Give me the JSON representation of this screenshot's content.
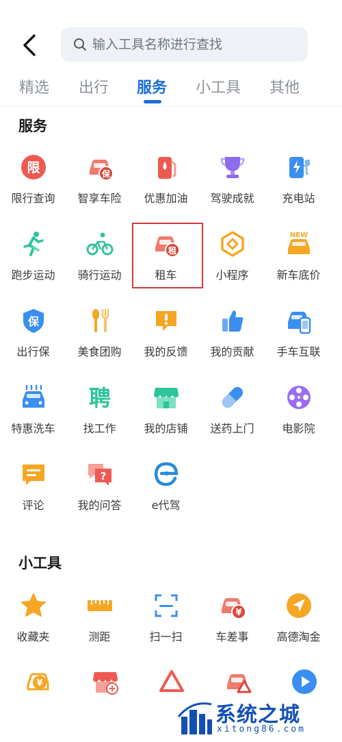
{
  "search": {
    "placeholder": "输入工具名称进行查找"
  },
  "tabs": [
    {
      "label": "精选"
    },
    {
      "label": "出行"
    },
    {
      "label": "服务"
    },
    {
      "label": "小工具"
    },
    {
      "label": "其他"
    }
  ],
  "active_tab": "服务",
  "sections": {
    "service": {
      "title": "服务",
      "items": [
        {
          "label": "限行查询",
          "icon": "restriction-icon"
        },
        {
          "label": "智享车险",
          "icon": "car-insurance-icon"
        },
        {
          "label": "优惠加油",
          "icon": "fuel-icon"
        },
        {
          "label": "驾驶成就",
          "icon": "trophy-icon"
        },
        {
          "label": "充电站",
          "icon": "charging-icon"
        },
        {
          "label": "跑步运动",
          "icon": "running-icon"
        },
        {
          "label": "骑行运动",
          "icon": "cycling-icon"
        },
        {
          "label": "租车",
          "icon": "car-rental-icon",
          "highlighted": true
        },
        {
          "label": "小程序",
          "icon": "mini-program-icon"
        },
        {
          "label": "新车底价",
          "icon": "new-car-icon"
        },
        {
          "label": "出行保",
          "icon": "shield-icon"
        },
        {
          "label": "美食团购",
          "icon": "food-icon"
        },
        {
          "label": "我的反馈",
          "icon": "feedback-icon"
        },
        {
          "label": "我的贡献",
          "icon": "thumbs-up-icon"
        },
        {
          "label": "手车互联",
          "icon": "phone-car-icon"
        },
        {
          "label": "特惠洗车",
          "icon": "car-wash-icon"
        },
        {
          "label": "找工作",
          "icon": "job-icon"
        },
        {
          "label": "我的店铺",
          "icon": "shop-icon"
        },
        {
          "label": "送药上门",
          "icon": "pill-icon"
        },
        {
          "label": "电影院",
          "icon": "film-reel-icon"
        },
        {
          "label": "评论",
          "icon": "comment-icon"
        },
        {
          "label": "我的问答",
          "icon": "qa-icon"
        },
        {
          "label": "e代驾",
          "icon": "e-driver-icon"
        }
      ]
    },
    "tools": {
      "title": "小工具",
      "items": [
        {
          "label": "收藏夹",
          "icon": "star-icon"
        },
        {
          "label": "测距",
          "icon": "ruler-icon"
        },
        {
          "label": "扫一扫",
          "icon": "scan-icon"
        },
        {
          "label": "车差事",
          "icon": "car-expense-icon"
        },
        {
          "label": "高德淘金",
          "icon": "gold-rush-icon"
        }
      ]
    }
  },
  "badges": {
    "new": "NEW",
    "rent": "租",
    "insurance": "保",
    "service": "保",
    "yuan": "¥",
    "e": "e",
    "job": "聘",
    "question": "?"
  },
  "watermark": {
    "title": "系统之城",
    "url": "xitong86.com"
  },
  "colors": {
    "accent": "#1a6ddc",
    "highlight_border": "#d0373d",
    "red": "#ee5a52",
    "orange": "#f5a623",
    "blue": "#3a8ef0",
    "green": "#2cc49a"
  }
}
